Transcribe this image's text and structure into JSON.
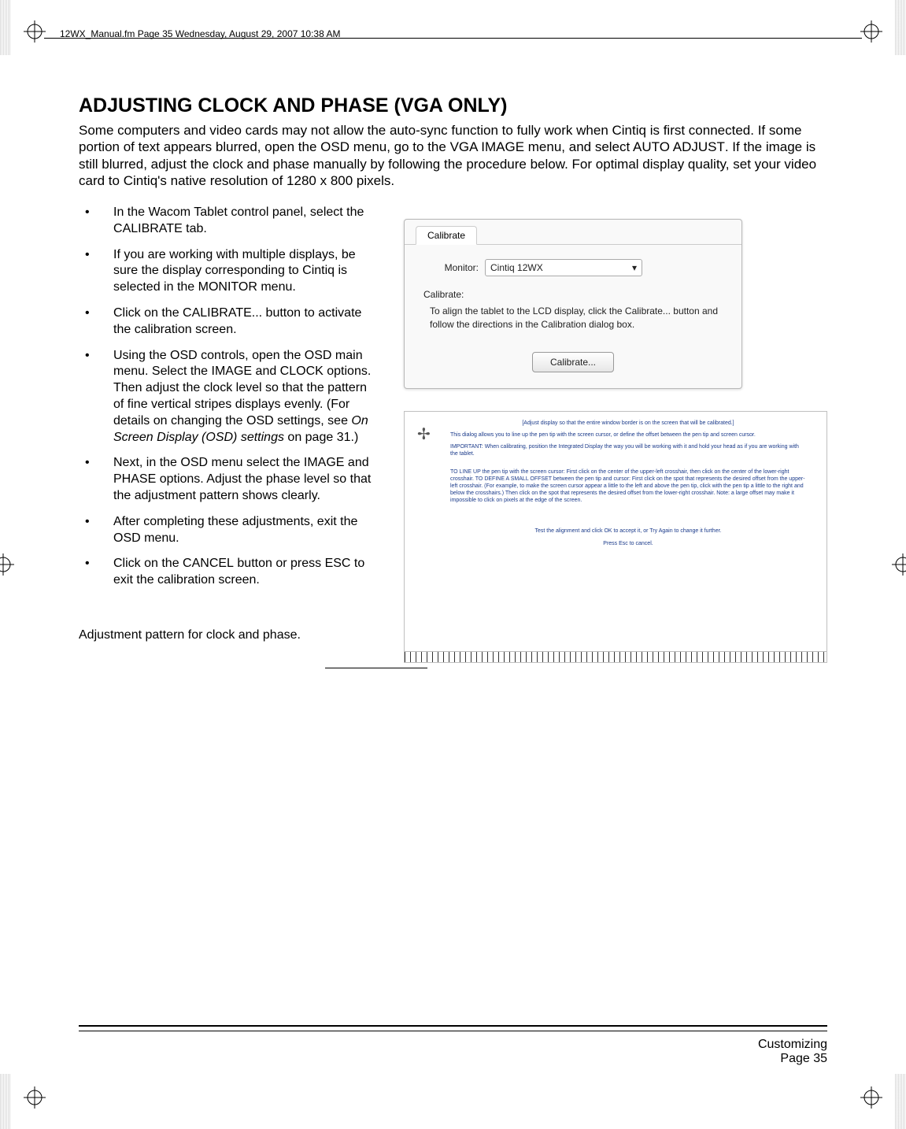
{
  "print_header": "12WX_Manual.fm  Page 35  Wednesday, August 29, 2007  10:38 AM",
  "title": "ADJUSTING CLOCK AND PHASE (VGA ONLY)",
  "intro_parts": {
    "p1a": "Some computers and video cards may not allow the auto-sync function to fully work when Cintiq is first connected.  If some portion of text appears blurred, open the OSD menu, go to the VGA I",
    "p1b": "MAGE",
    "p1c": " menu, and select A",
    "p1d": "UTO",
    "p1e": " A",
    "p1f": "DJUST",
    "p1g": ".  If the image is still blurred, adjust the clock and phase manually by following the procedure below.  For optimal display quality, set your video card to Cintiq's native resolution of 1280 x 800 pixels."
  },
  "bullets": [
    {
      "a": "In the Wacom Tablet control panel, select the C",
      "b": "ALIBRATE",
      "c": " tab."
    },
    {
      "a": "If you are working with multiple displays, be sure the display corresponding to Cintiq is selected in the M",
      "b": "ONITOR",
      "c": " menu."
    },
    {
      "a": "Click on the C",
      "b": "ALIBRATE",
      "c": "... button to activate the calibration screen."
    },
    {
      "a": "Using the OSD controls, open the OSD main menu.  Select the I",
      "b": "MAGE",
      "c": " and C",
      "d": "LOCK",
      "e": " options.  Then adjust the clock level so that the pattern of fine vertical stripes displays evenly.  (For details on changing the OSD settings, see ",
      "it": "On Screen Display (OSD) settings",
      "f": " on page 31.)"
    },
    {
      "a": "Next, in the OSD menu select the I",
      "b": "MAGE",
      "c": " and P",
      "d": "HASE",
      "e": " options.  Adjust the phase level so that the adjustment pattern shows clearly."
    },
    {
      "a": "After completing these adjustments, exit the OSD menu."
    },
    {
      "a": "Click on the C",
      "b": "ANCEL",
      "c": " button or press E",
      "d": "SC",
      "e": " to exit the calibration screen."
    }
  ],
  "dialog1": {
    "tab": "Calibrate",
    "monitor_label": "Monitor:",
    "monitor_value": "Cintiq 12WX",
    "calibrate_label": "Calibrate:",
    "explain": "To align the tablet to the LCD display, click the Calibrate... button and follow the directions in the Calibration dialog box.",
    "button": "Calibrate..."
  },
  "dialog2": {
    "headline": "[Adjust display so that the entire window border is on the screen that will be calibrated.]",
    "p1": "This dialog allows you to line up the pen tip with the screen cursor, or define the offset between the pen tip and screen cursor.",
    "p2": "IMPORTANT: When calibrating, position the Integrated Display the way you will be working with it and hold your head as if you are working with the tablet.",
    "p3": "TO LINE UP the pen tip with the screen cursor: First click on the center of the upper-left crosshair, then click on the center of the lower-right crosshair. TO DEFINE A SMALL OFFSET between the pen tip and cursor: First click on the spot that represents the desired offset from the upper-left crosshair. (For example, to make the screen cursor appear a little to the left and above the pen tip, click with the pen tip a little to the right and below the crosshairs.) Then click on the spot that represents the desired offset from the lower-right crosshair. Note: a large offset may make it impossible to click on pixels at the edge of the screen.",
    "tail1": "Test the alignment and click OK to accept it, or Try Again to change it further.",
    "tail2": "Press Esc to cancel."
  },
  "caption": "Adjustment pattern for clock and phase.",
  "footer": {
    "section": "Customizing",
    "page": "Page  35"
  }
}
